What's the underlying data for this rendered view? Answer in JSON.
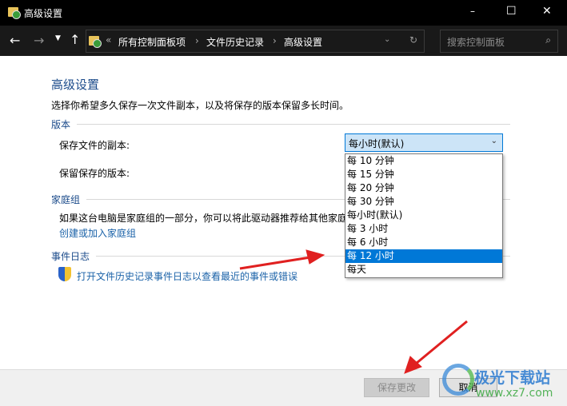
{
  "window": {
    "title": "高级设置",
    "controls": {
      "minimize": "–",
      "maximize": "☐",
      "close": "✕"
    }
  },
  "address": {
    "prefix": "«",
    "crumbs": [
      "所有控制面板项",
      "文件历史记录",
      "高级设置"
    ],
    "search_placeholder": "搜索控制面板"
  },
  "main": {
    "heading": "高级设置",
    "description": "选择你希望多久保存一次文件副本，以及将保存的版本保留多长时间。",
    "versions": {
      "label": "版本",
      "save_copies_label": "保存文件的副本:",
      "keep_versions_label": "保留保存的版本:",
      "selected": "每小时(默认)",
      "options": [
        "每 10 分钟",
        "每 15 分钟",
        "每 20 分钟",
        "每 30 分钟",
        "每小时(默认)",
        "每 3 小时",
        "每 6 小时",
        "每 12 小时",
        "每天"
      ],
      "highlighted_index": 7
    },
    "homegroup": {
      "label": "家庭组",
      "text": "如果这台电脑是家庭组的一部分，你可以将此驱动器推荐给其他家庭",
      "link": "创建或加入家庭组"
    },
    "eventlog": {
      "label": "事件日志",
      "link": "打开文件历史记录事件日志以查看最近的事件或错误"
    }
  },
  "footer": {
    "save": "保存更改",
    "cancel": "取消"
  },
  "watermark": {
    "name": "极光下载站",
    "url": "www.xz7.com"
  },
  "colors": {
    "accent": "#0078d7",
    "link": "#1a62a8",
    "arrow": "#e02020"
  }
}
